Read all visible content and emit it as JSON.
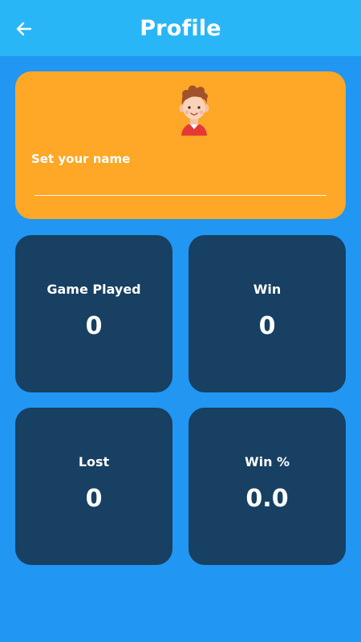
{
  "header": {
    "title": "Profile",
    "back_icon": "arrow-left-icon"
  },
  "profile": {
    "avatar_icon": "boy-avatar-icon",
    "name_label": "Set your name",
    "name_value": ""
  },
  "stats": [
    {
      "label": "Game Played",
      "value": "0"
    },
    {
      "label": "Win",
      "value": "0"
    },
    {
      "label": "Lost",
      "value": "0"
    },
    {
      "label": "Win %",
      "value": "0.0"
    }
  ],
  "colors": {
    "background": "#2196F3",
    "appbar": "#29B6F6",
    "profile_card": "#FFA726",
    "stat_card": "#174062",
    "text": "#FFFFFF"
  }
}
